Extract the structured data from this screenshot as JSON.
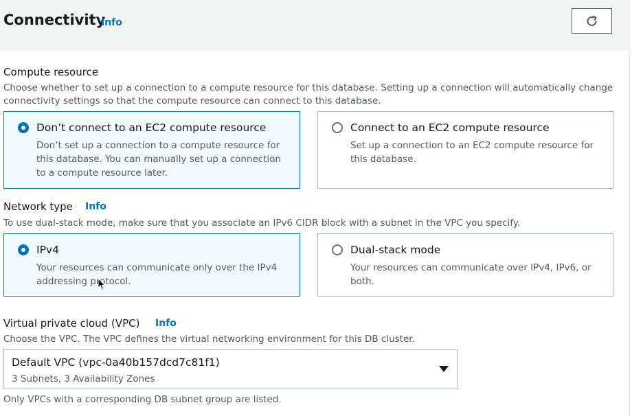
{
  "header": {
    "title": "Connectivity",
    "info": "Info"
  },
  "compute": {
    "label": "Compute resource",
    "description": "Choose whether to set up a connection to a compute resource for this database. Setting up a connection will automatically change connectivity settings so that the compute resource can connect to this database.",
    "options": [
      {
        "title": "Don’t connect to an EC2 compute resource",
        "desc": "Don’t set up a connection to a compute resource for this database. You can manually set up a connection to a compute resource later.",
        "selected": true
      },
      {
        "title": "Connect to an EC2 compute resource",
        "desc": "Set up a connection to an EC2 compute resource for this database.",
        "selected": false
      }
    ]
  },
  "network": {
    "label": "Network type",
    "info": "Info",
    "description": "To use dual-stack mode, make sure that you associate an IPv6 CIDR block with a subnet in the VPC you specify.",
    "options": [
      {
        "title": "IPv4",
        "desc": "Your resources can communicate only over the IPv4 addressing protocol.",
        "selected": true
      },
      {
        "title": "Dual-stack mode",
        "desc": "Your resources can communicate over IPv4, IPv6, or both.",
        "selected": false
      }
    ]
  },
  "vpc": {
    "label": "Virtual private cloud (VPC)",
    "info": "Info",
    "description": "Choose the VPC. The VPC defines the virtual networking environment for this DB cluster.",
    "selected_value": "Default VPC (vpc-0a40b157dcd7c81f1)",
    "selected_sub": "3 Subnets, 3 Availability Zones",
    "footnote": "Only VPCs with a corresponding DB subnet group are listed."
  },
  "colors": {
    "accent": "#0073bb",
    "selected_bg": "#f1faff",
    "header_bg": "#f2f3f3"
  },
  "icons": {
    "refresh": "refresh-icon",
    "dropdown": "caret-down-icon",
    "cursor": "mouse-pointer-icon"
  }
}
